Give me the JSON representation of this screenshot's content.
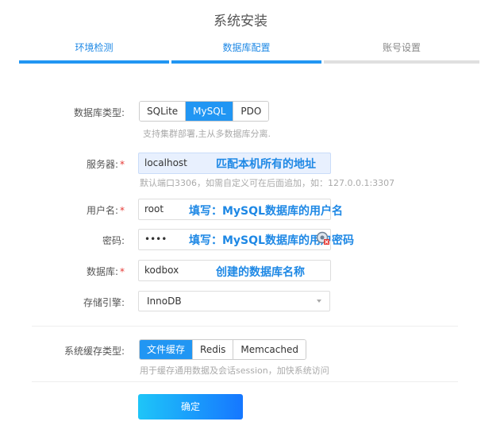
{
  "title": "系统安装",
  "steps": [
    {
      "label": "环境检测",
      "state": "active"
    },
    {
      "label": "数据库配置",
      "state": "active"
    },
    {
      "label": "账号设置",
      "state": "todo"
    }
  ],
  "db_type": {
    "label": "数据库类型:",
    "options": [
      "SQLite",
      "MySQL",
      "PDO"
    ],
    "selected": "MySQL",
    "hint": "支持集群部署,主从多数据库分离."
  },
  "server": {
    "label": "服务器:",
    "value": "localhost",
    "annotation": "匹配本机所有的地址",
    "hint": "默认端口3306，如需自定义可在后面追加，如：127.0.0.1:3307"
  },
  "username": {
    "label": "用户名:",
    "value": "root",
    "annotation": "填写：MySQL数据库的用户名"
  },
  "password": {
    "label": "密码:",
    "value": "••••",
    "annotation": "填写：MySQL数据库的用户密码"
  },
  "database": {
    "label": "数据库:",
    "value": "kodbox",
    "annotation": "创建的数据库名称"
  },
  "engine": {
    "label": "存储引擎:",
    "value": "InnoDB"
  },
  "cache_type": {
    "label": "系统缓存类型:",
    "options": [
      "文件缓存",
      "Redis",
      "Memcached"
    ],
    "selected": "文件缓存",
    "hint": "用于缓存通用数据及会话session，加快系统访问"
  },
  "submit_label": "确定",
  "accent": "#2196f3",
  "required_mark": "*"
}
